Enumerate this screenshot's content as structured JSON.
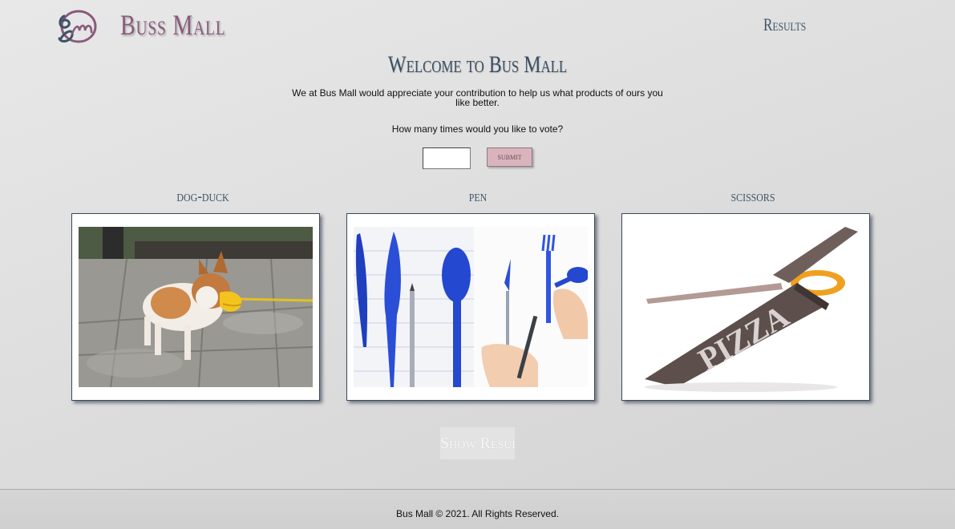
{
  "header": {
    "logo_text": "BM",
    "site_title": "Buss Mall",
    "nav_results_label": "Results"
  },
  "main": {
    "welcome_title": "Welcome to Bus Mall",
    "intro_text": "We at Bus Mall would appreciate your contribution to help us what products of ours you like better.",
    "vote_question": "How many times would you like to vote?",
    "vote_input_value": "",
    "submit_label": "submit",
    "products": [
      {
        "name": "dog-duck"
      },
      {
        "name": "pen"
      },
      {
        "name": "scissors"
      }
    ],
    "show_results_label": "Show Results"
  },
  "footer": {
    "text": "Bus Mall © 2021. All Rights Reserved."
  },
  "colors": {
    "title_plum": "#8a5a7a",
    "heading_slate": "#3b4f62",
    "submit_pink": "#d9b4bd"
  }
}
